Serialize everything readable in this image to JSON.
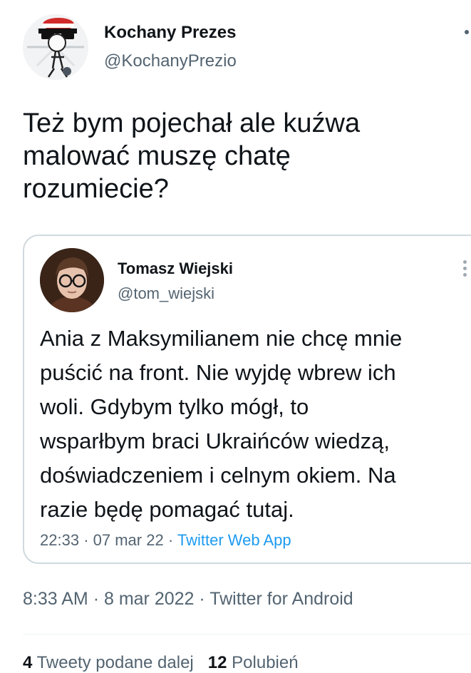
{
  "tweet": {
    "author_name": "Kochany Prezes",
    "author_handle": "@KochanyPrezio",
    "text": "Też bym pojechał ale kuźwa\nmalować muszę chatę\nrozumiecie?",
    "time": "8:33 AM",
    "date": "8 mar 2022",
    "source": "Twitter for Android"
  },
  "quote": {
    "author_name": "Tomasz Wiejski",
    "author_handle": "@tom_wiejski",
    "text": "Ania z Maksymilianem nie chcę mnie\npuścić na front. Nie wyjdę wbrew ich\nwoli. Gdybym tylko mógł, to\nwsparłbym braci Ukraińców wiedzą,\ndoświadczeniem i celnym okiem. Na\nrazie będę pomagać tutaj.",
    "time": "22:33",
    "date": "07 mar 22",
    "source": "Twitter Web App"
  },
  "separator": "·",
  "stats": {
    "retweets_count": "4",
    "retweets_label": "Tweety podane dalej",
    "quotes_count": "12",
    "quotes_label": "Polubień"
  },
  "colors": {
    "text": "#0f1419",
    "secondary": "#536471",
    "link": "#1d9bf0",
    "border": "#cfd9de"
  },
  "icons": {
    "author_avatar": "cartoon-avatar-with-sunglasses",
    "quote_avatar": "photo-avatar-with-glasses",
    "more": "more-dots-icon"
  }
}
